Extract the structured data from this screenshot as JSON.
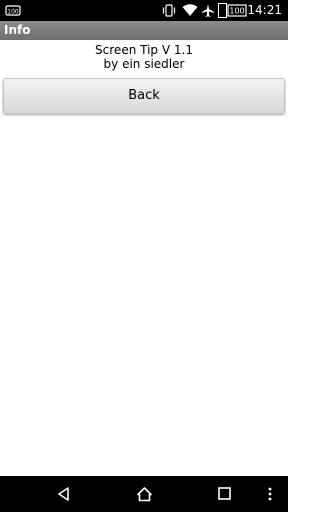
{
  "status_bar": {
    "carrier_icon": "notification-app-icon",
    "vibrate_icon": "vibrate-icon",
    "wifi_icon": "wifi-icon",
    "airplane_icon": "airplane-icon",
    "battery_icon": "battery-icon",
    "battery_level": "100",
    "time": "14:21"
  },
  "title_bar": {
    "title": "Info"
  },
  "content": {
    "line1": "Screen Tip V 1.1",
    "line2": "by ein siedler",
    "back_label": "Back"
  },
  "nav_bar": {
    "back_icon": "triangle-back-icon",
    "home_icon": "home-icon",
    "recents_icon": "square-recents-icon",
    "menu_icon": "vertical-dots-icon"
  }
}
